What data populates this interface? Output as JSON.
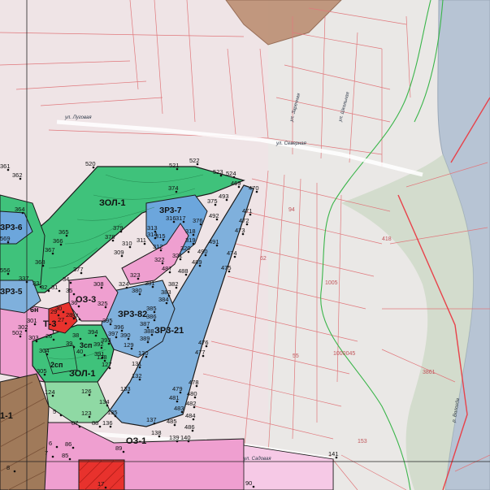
{
  "colors": {
    "background": "#f3e9ea",
    "river": "#b7c4d4",
    "green_zone": "#3fc27b",
    "green_zone_light": "#8fd9a4",
    "blue_zone": "#7fb0dc",
    "blue_zone_dark": "#5f95cc",
    "pink_zone": "#ef9fd0",
    "pink_zone_light": "#f6c9e6",
    "red_zone": "#e8322d",
    "brown_zone": "#a07a5a",
    "cadastre_line": "#e0787c",
    "zone_border": "#1a1a1a",
    "road_green": "#3ab54a"
  },
  "zones": [
    {
      "id": "zl1_top",
      "label": "ЗОЛ-1"
    },
    {
      "id": "zr6",
      "label": "ЗР3-6"
    },
    {
      "id": "zr7",
      "label": "ЗР3-7"
    },
    {
      "id": "zr5",
      "label": "ЗР3-5"
    },
    {
      "id": "oz3",
      "label": "ОЗ-3"
    },
    {
      "id": "zr82",
      "label": "ЗР3-82"
    },
    {
      "id": "zr21",
      "label": "ЗР3-21"
    },
    {
      "id": "t3",
      "label": "Т-3"
    },
    {
      "id": "cn",
      "label": "3сп"
    },
    {
      "id": "cn2",
      "label": "2сп"
    },
    {
      "id": "zl1_bottom",
      "label": "ЗОЛ-1"
    },
    {
      "id": "oz1",
      "label": "ОЗ-1"
    },
    {
      "id": "left_zone",
      "label": "1-1"
    },
    {
      "id": "bn",
      "label": "6н"
    }
  ],
  "points": [
    "520",
    "521",
    "522",
    "523",
    "524",
    "469",
    "470",
    "471",
    "472",
    "473",
    "474",
    "475",
    "476",
    "477",
    "478",
    "479",
    "480",
    "481",
    "482",
    "483",
    "484",
    "485",
    "486",
    "374",
    "375",
    "376",
    "318",
    "319",
    "320",
    "321",
    "322",
    "316",
    "317",
    "313",
    "314",
    "315",
    "311",
    "310",
    "309",
    "312",
    "379",
    "378",
    "377",
    "365",
    "366",
    "367",
    "368",
    "364",
    "569",
    "361",
    "362",
    "556",
    "337",
    "308",
    "323",
    "324",
    "325",
    "380",
    "381",
    "382",
    "383",
    "384",
    "385",
    "386",
    "387",
    "388",
    "389",
    "390",
    "391",
    "392",
    "393",
    "394",
    "395",
    "396",
    "397",
    "126",
    "127",
    "128",
    "129",
    "130",
    "131",
    "132",
    "133",
    "134",
    "135",
    "136",
    "137",
    "138",
    "139",
    "140",
    "141",
    "124",
    "123",
    "88",
    "87",
    "86",
    "85",
    "89",
    "90",
    "5",
    "6",
    "7",
    "8",
    "17",
    "305",
    "304",
    "502",
    "303",
    "302",
    "301",
    "26",
    "27",
    "28",
    "29",
    "30",
    "31",
    "32",
    "33",
    "34",
    "35",
    "36",
    "37",
    "38",
    "39",
    "40",
    "487",
    "488",
    "489",
    "490",
    "491",
    "492",
    "493"
  ],
  "cadastral_numbers": [
    "418",
    "1000045",
    "3861",
    "1005",
    "153",
    "55",
    "94",
    "62"
  ],
  "streets": [
    "ул. Луговая",
    "ул. Северная",
    "ул. Заречная",
    "ул. Школьная",
    "ул. Садовая",
    "р. Вологда"
  ]
}
